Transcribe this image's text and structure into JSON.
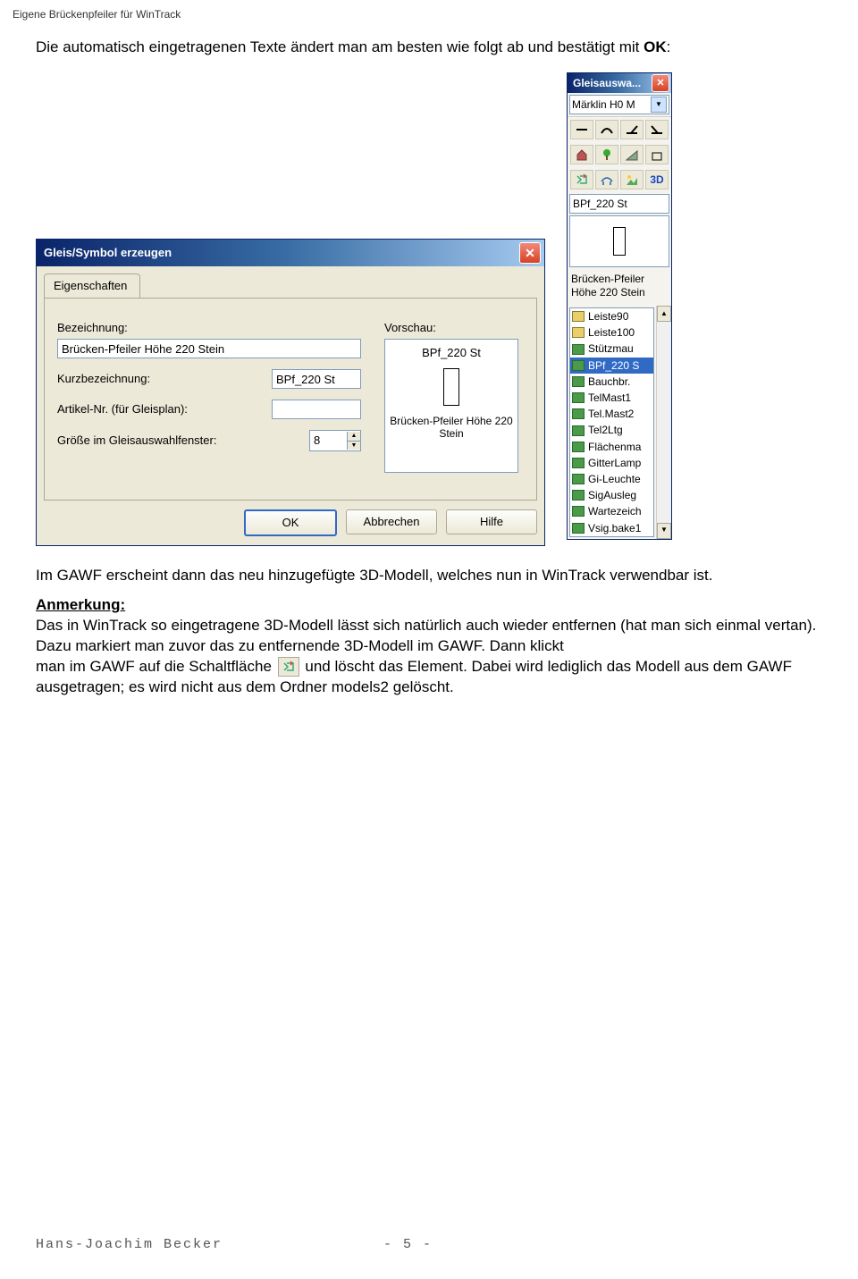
{
  "header": "Eigene Brückenpfeiler für WinTrack",
  "p1_a": "Die automatisch eingetragenen Texte ändert man am besten wie folgt ab und bestätigt mit ",
  "p1_b": "OK",
  "p1_c": ":",
  "p2": "Im GAWF erscheint dann das neu hinzugefügte 3D-Modell, welches nun in WinTrack verwendbar ist.",
  "p3_h": "Anmerkung:",
  "p3_a": "Das in WinTrack so eingetragene 3D-Modell lässt sich natürlich auch wieder entfernen (hat man sich einmal vertan). Dazu markiert man zuvor das zu entfernende 3D-Modell im GAWF. Dann klickt",
  "p3_b": "man im GAWF auf die Schaltfläche",
  "p3_c": "und löscht das Element. Dabei wird lediglich das Modell aus dem GAWF ausgetragen; es wird nicht aus dem Ordner models2 gelöscht.",
  "dialog": {
    "title": "Gleis/Symbol erzeugen",
    "tab": "Eigenschaften",
    "l_bez": "Bezeichnung:",
    "v_bez": "Brücken-Pfeiler Höhe 220 Stein",
    "l_kurz": "Kurzbezeichnung:",
    "v_kurz": "BPf_220 St",
    "l_art": "Artikel-Nr. (für Gleisplan):",
    "v_art": "",
    "l_size": "Größe im Gleisauswahlfenster:",
    "v_size": "8",
    "l_vor": "Vorschau:",
    "prev_short": "BPf_220 St",
    "prev_long": "Brücken-Pfeiler Höhe 220 Stein",
    "btn_ok": "OK",
    "btn_cancel": "Abbrechen",
    "btn_help": "Hilfe"
  },
  "palette": {
    "title": "Gleisauswa...",
    "combo": "Märklin H0 M",
    "short": "BPf_220 St",
    "desc": "Brücken-Pfeiler Höhe 220 Stein",
    "items": [
      {
        "ic": "y",
        "t": "Leiste90"
      },
      {
        "ic": "y",
        "t": "Leiste100"
      },
      {
        "ic": "g",
        "t": "Stützmau"
      },
      {
        "ic": "g",
        "t": "BPf_220 S",
        "sel": true
      },
      {
        "ic": "g",
        "t": "Bauchbr."
      },
      {
        "ic": "g",
        "t": "TelMast1"
      },
      {
        "ic": "g",
        "t": "Tel.Mast2"
      },
      {
        "ic": "g",
        "t": "Tel2Ltg"
      },
      {
        "ic": "g",
        "t": "Flächenma"
      },
      {
        "ic": "g",
        "t": "GitterLamp"
      },
      {
        "ic": "g",
        "t": "Gi-Leuchte"
      },
      {
        "ic": "g",
        "t": "SigAusleg"
      },
      {
        "ic": "g",
        "t": "Wartezeich"
      },
      {
        "ic": "g",
        "t": "Vsig.bake1"
      }
    ]
  },
  "footer": {
    "author": "Hans-Joachim Becker",
    "page": "- 5 -"
  }
}
